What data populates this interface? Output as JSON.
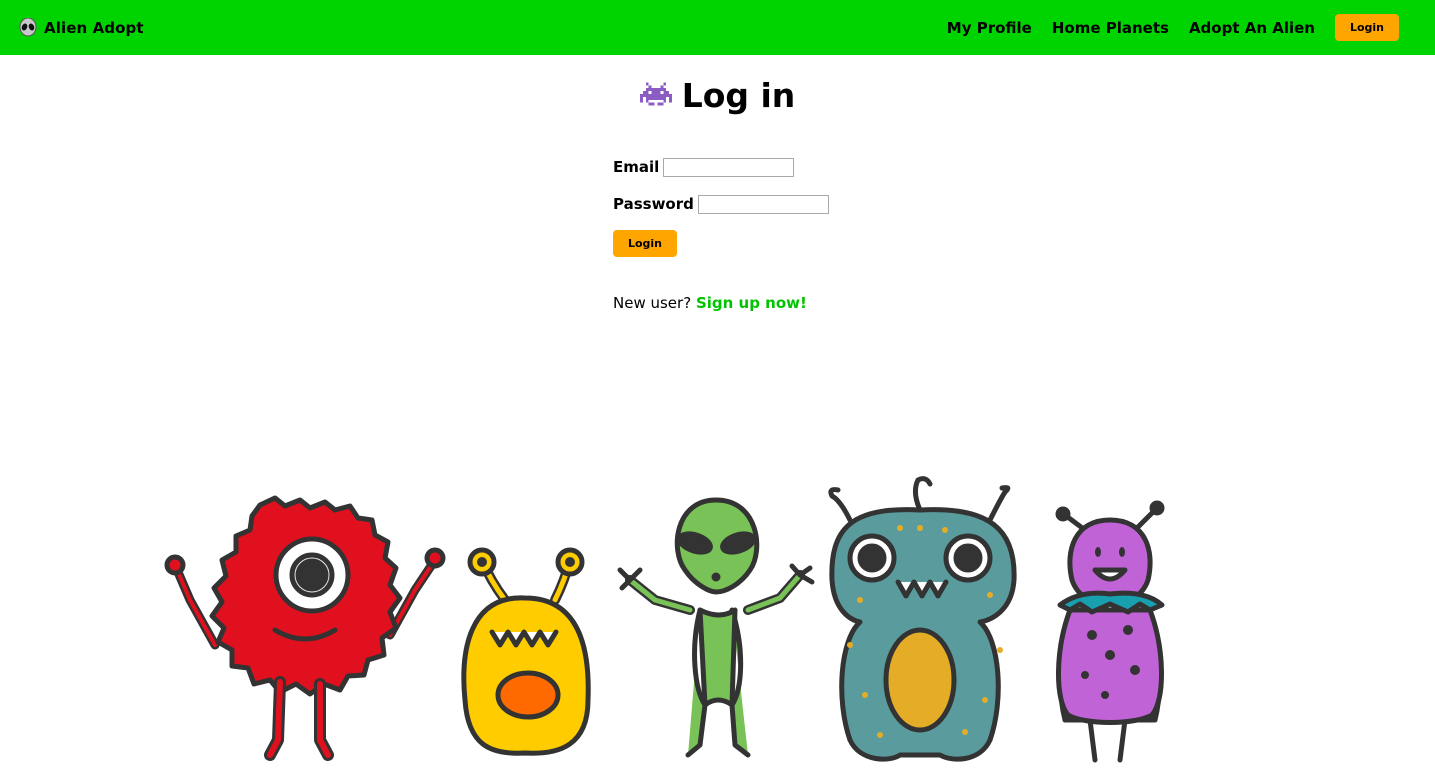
{
  "navbar": {
    "brand_icon": "alien-face-icon",
    "brand_label": "Alien Adopt",
    "links": [
      "My Profile",
      "Home Planets",
      "Adopt An Alien"
    ],
    "login_label": "Login",
    "bg_color": "#00d400",
    "accent_color": "#ffa500"
  },
  "page": {
    "title_icon": "space-invader-icon",
    "title": "Log in"
  },
  "form": {
    "email_label": "Email",
    "email_value": "",
    "password_label": "Password",
    "password_value": "",
    "submit_label": "Login"
  },
  "signup": {
    "prompt": "New user?",
    "link_label": "Sign up now!"
  },
  "illustration": {
    "figures": [
      "red-fuzzy-cyclops",
      "yellow-blob-monster",
      "green-alien",
      "teal-spotted-monster",
      "purple-alien"
    ]
  }
}
